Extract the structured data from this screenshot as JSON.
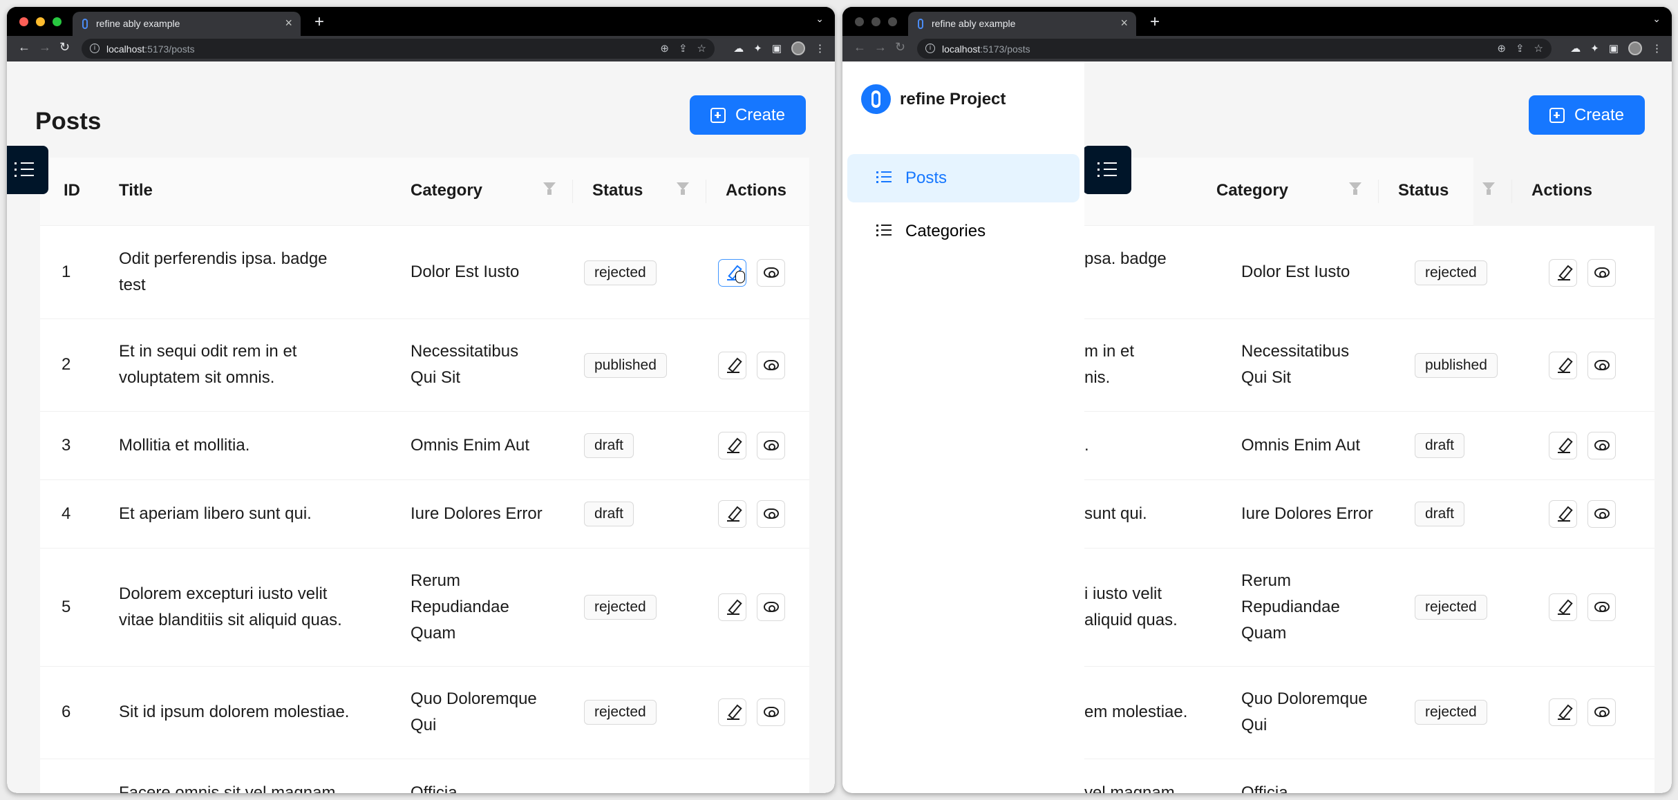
{
  "browser": {
    "tab_title": "refine ably example",
    "url_host": "localhost",
    "url_path": ":5173/posts",
    "tab_close": "×",
    "new_tab": "+",
    "tab_menu": "⌄",
    "nav_back": "←",
    "nav_forward": "→",
    "nav_reload": "↻",
    "menu_dots": "⋮"
  },
  "page": {
    "title": "Posts",
    "create_label": "Create"
  },
  "sider": {
    "brand": "refine Project",
    "items": [
      {
        "label": "Posts",
        "selected": true
      },
      {
        "label": "Categories",
        "selected": false
      }
    ]
  },
  "table": {
    "columns": [
      "ID",
      "Title",
      "Category",
      "Status",
      "Actions"
    ],
    "rows": [
      {
        "id": "1",
        "title": [
          "Odit perferendis ipsa. badge",
          "test"
        ],
        "category": [
          "Dolor Est Iusto"
        ],
        "status": "rejected"
      },
      {
        "id": "2",
        "title": [
          "Et in sequi odit rem in et",
          "voluptatem sit omnis."
        ],
        "category": [
          "Necessitatibus",
          "Qui Sit"
        ],
        "status": "published"
      },
      {
        "id": "3",
        "title": [
          "Mollitia et mollitia."
        ],
        "category": [
          "Omnis Enim Aut"
        ],
        "status": "draft"
      },
      {
        "id": "4",
        "title": [
          "Et aperiam libero sunt qui."
        ],
        "category": [
          "Iure Dolores Error"
        ],
        "status": "draft"
      },
      {
        "id": "5",
        "title": [
          "Dolorem excepturi iusto velit",
          "vitae blanditiis sit aliquid quas."
        ],
        "category": [
          "Rerum",
          "Repudiandae",
          "Quam"
        ],
        "status": "rejected"
      },
      {
        "id": "6",
        "title": [
          "Sit id ipsum dolorem molestiae."
        ],
        "category": [
          "Quo Doloremque",
          "Qui"
        ],
        "status": "rejected"
      },
      {
        "id": "",
        "title": [
          "Facere omnis sit vel magnam"
        ],
        "category": [
          "Officia"
        ],
        "status": ""
      }
    ],
    "right_window_title_fragments": [
      [
        "psa. badge",
        ""
      ],
      [
        "m in et",
        "nis."
      ],
      [
        "."
      ],
      [
        "sunt qui."
      ],
      [
        "i iusto velit",
        "aliquid quas."
      ],
      [
        "em molestiae."
      ],
      [
        "vel magnam"
      ]
    ]
  },
  "colors": {
    "primary": "#1677ff",
    "sider_toggle": "#001529",
    "selected_menu_bg": "#e6f4ff",
    "traffic_red": "#ff5f57",
    "traffic_yellow": "#febc2e",
    "traffic_green": "#28c840"
  },
  "icons": [
    "list-icon",
    "filter-icon",
    "edit-icon",
    "eye-icon",
    "plus-square-icon",
    "pointer-cursor-icon"
  ]
}
